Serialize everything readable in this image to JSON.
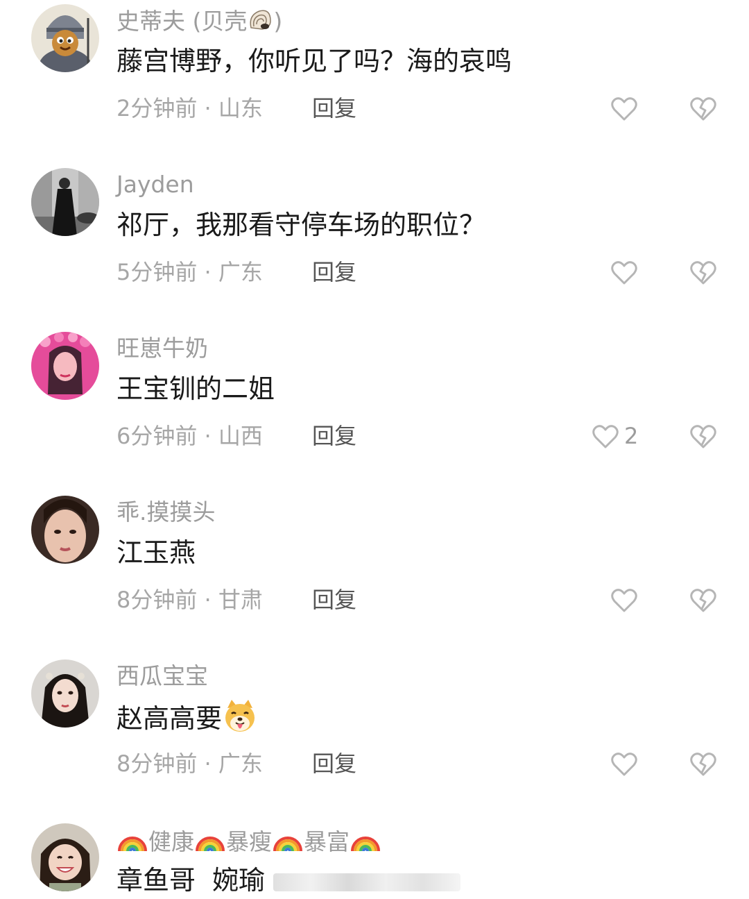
{
  "comments": [
    {
      "username": "史蒂夫 (贝壳",
      "username_suffix": ")",
      "username_emoji": "spiral-shell-emoji",
      "text": "藤宫博野，你听见了吗？海的哀鸣",
      "time": "2分钟前 · 山东",
      "reply": "回复",
      "avatar": "armored-warrior-avatar"
    },
    {
      "username": "Jayden",
      "text": "祁厅，我那看守停车场的职位？",
      "time": "5分钟前 · 广东",
      "reply": "回复",
      "avatar": "street-photo-avatar"
    },
    {
      "username": "旺崽牛奶",
      "text": "王宝钏的二姐",
      "time": "6分钟前 · 山西",
      "reply": "回复",
      "like_count": "2",
      "avatar": "pink-veil-avatar"
    },
    {
      "username": "乖.摸摸头",
      "text": "江玉燕",
      "time": "8分钟前 · 甘肃",
      "reply": "回复",
      "avatar": "portrait-avatar"
    },
    {
      "username": "西瓜宝宝",
      "text": "赵高高要",
      "text_emoji": "dog-tongue-emoji",
      "time": "8分钟前 · 广东",
      "reply": "回复",
      "avatar": "hanfu-portrait-avatar"
    },
    {
      "username_parts": [
        "健康",
        "暴瘦",
        "暴富"
      ],
      "username_emoji": "rainbow-emoji",
      "text": "章鱼哥  婉瑜",
      "avatar": "smiling-girl-avatar"
    }
  ],
  "colors": {
    "username": "#9c9c9c",
    "content": "#1a1a1a",
    "meta": "#a6a6a6",
    "reply": "#555555",
    "icon_stroke": "#b5b5b5"
  }
}
